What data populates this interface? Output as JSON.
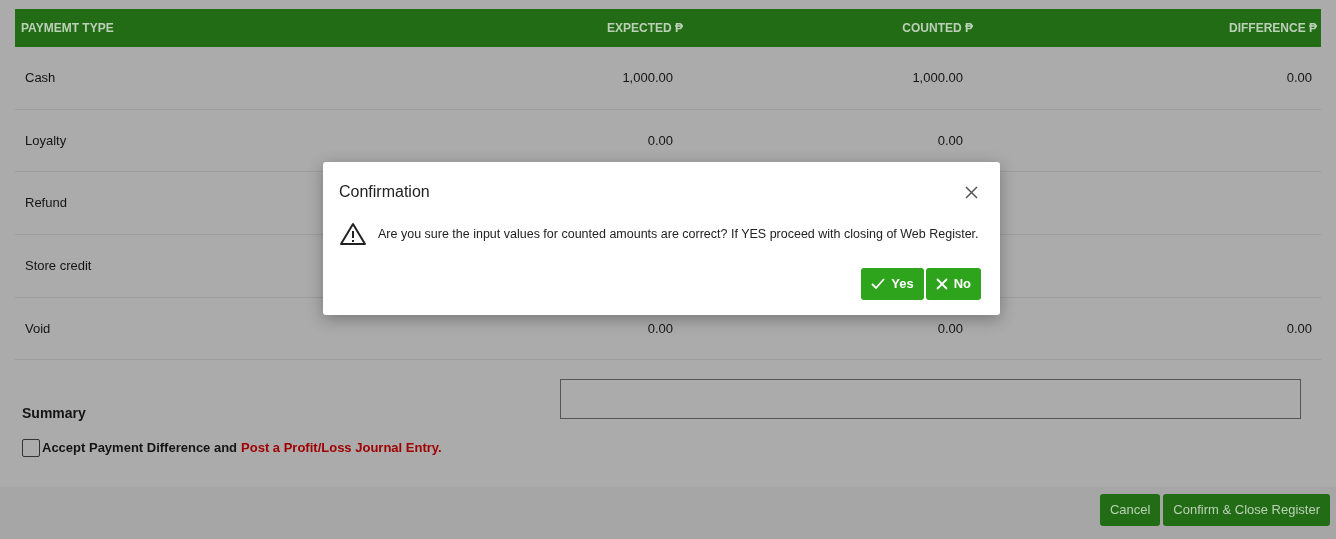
{
  "table": {
    "columns": [
      "PAYMEMT TYPE",
      "EXPECTED ₱",
      "COUNTED ₱",
      "DIFFERENCE ₱"
    ],
    "rows": [
      {
        "type": "Cash",
        "expected": "1,000.00",
        "counted": "1,000.00",
        "difference": "0.00"
      },
      {
        "type": "Loyalty",
        "expected": "0.00",
        "counted": "0.00"
      },
      {
        "type": "Refund"
      },
      {
        "type": "Store credit"
      },
      {
        "type": "Void",
        "expected": "0.00",
        "counted": "0.00",
        "difference": "0.00"
      }
    ]
  },
  "summary": {
    "label": "Summary"
  },
  "accept": {
    "checked": false,
    "label": "Accept Payment Difference and",
    "link": "Post a Profit/Loss Journal Entry."
  },
  "buttons": [
    "Cancel",
    "Confirm & Close Register"
  ],
  "dialog": {
    "title": "Confirmation",
    "message": "Are you sure the input values for counted amounts are correct? If YES proceed with closing of Web Register.",
    "buttons": [
      {
        "kind": "yes",
        "label": "Yes"
      },
      {
        "kind": "no",
        "label": "No"
      }
    ]
  }
}
